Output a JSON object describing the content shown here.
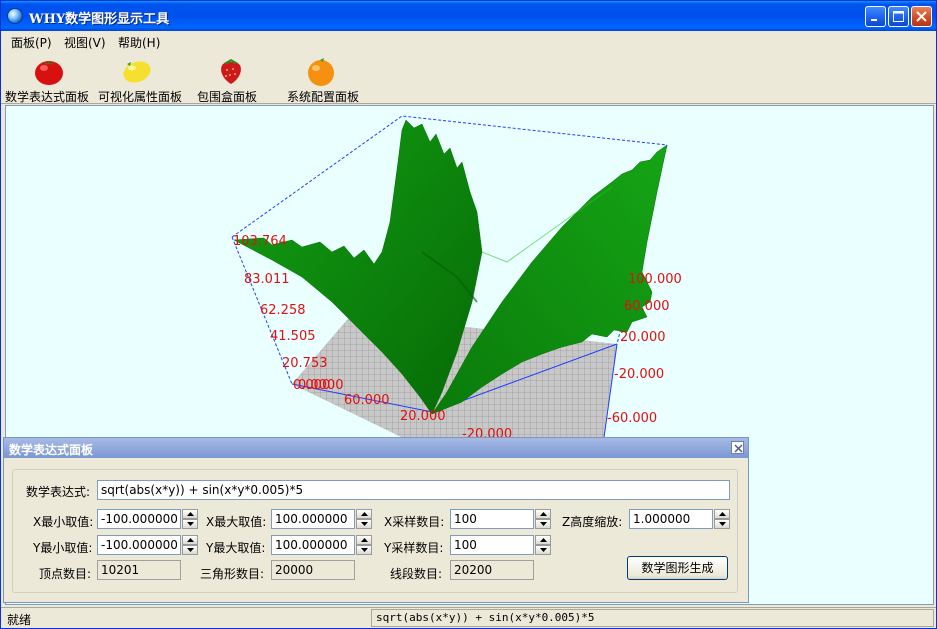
{
  "window": {
    "title": "WHY数学图形显示工具"
  },
  "menu": [
    "面板(P)",
    "视图(V)",
    "帮助(H)"
  ],
  "toolbar": {
    "items": [
      {
        "label": "数学表达式面板",
        "icon": "tomato-icon"
      },
      {
        "label": "可视化属性面板",
        "icon": "lemon-icon"
      },
      {
        "label": "包围盒面板",
        "icon": "strawberry-icon"
      },
      {
        "label": "系统配置面板",
        "icon": "orange-icon"
      }
    ]
  },
  "plot": {
    "z_ticks": [
      "103.764",
      "83.011",
      "62.258",
      "41.505",
      "20.753",
      "0.000"
    ],
    "x_ticks": [
      "0.0000",
      "60.000",
      "20.000",
      "-20.000"
    ],
    "y_ticks": [
      "100.000",
      "60.000",
      "20.000",
      "-20.000",
      "-60.000"
    ],
    "colors": {
      "surface": "#0d8a0d",
      "box": "#1f3fff",
      "grid": "#9a9a9a",
      "labels": "#e01010"
    }
  },
  "panel": {
    "title": "数学表达式面板",
    "expression_label": "数学表达式:",
    "expression": "sqrt(abs(x*y)) + sin(x*y*0.005)*5",
    "x_min_label": "X最小取值:",
    "x_min": "-100.000000",
    "x_max_label": "X最大取值:",
    "x_max": "100.000000",
    "x_samples_label": "X采样数目:",
    "x_samples": "100",
    "z_scale_label": "Z高度缩放:",
    "z_scale": "1.000000",
    "y_min_label": "Y最小取值:",
    "y_min": "-100.000000",
    "y_max_label": "Y最大取值:",
    "y_max": "100.000000",
    "y_samples_label": "Y采样数目:",
    "y_samples": "100",
    "vertex_label": "顶点数目:",
    "vertex_count": "10201",
    "triangle_label": "三角形数目:",
    "triangle_count": "20000",
    "segment_label": "线段数目:",
    "segment_count": "20200",
    "generate_button": "数学图形生成"
  },
  "status": {
    "left": "就绪",
    "right": "sqrt(abs(x*y)) + sin(x*y*0.005)*5"
  }
}
